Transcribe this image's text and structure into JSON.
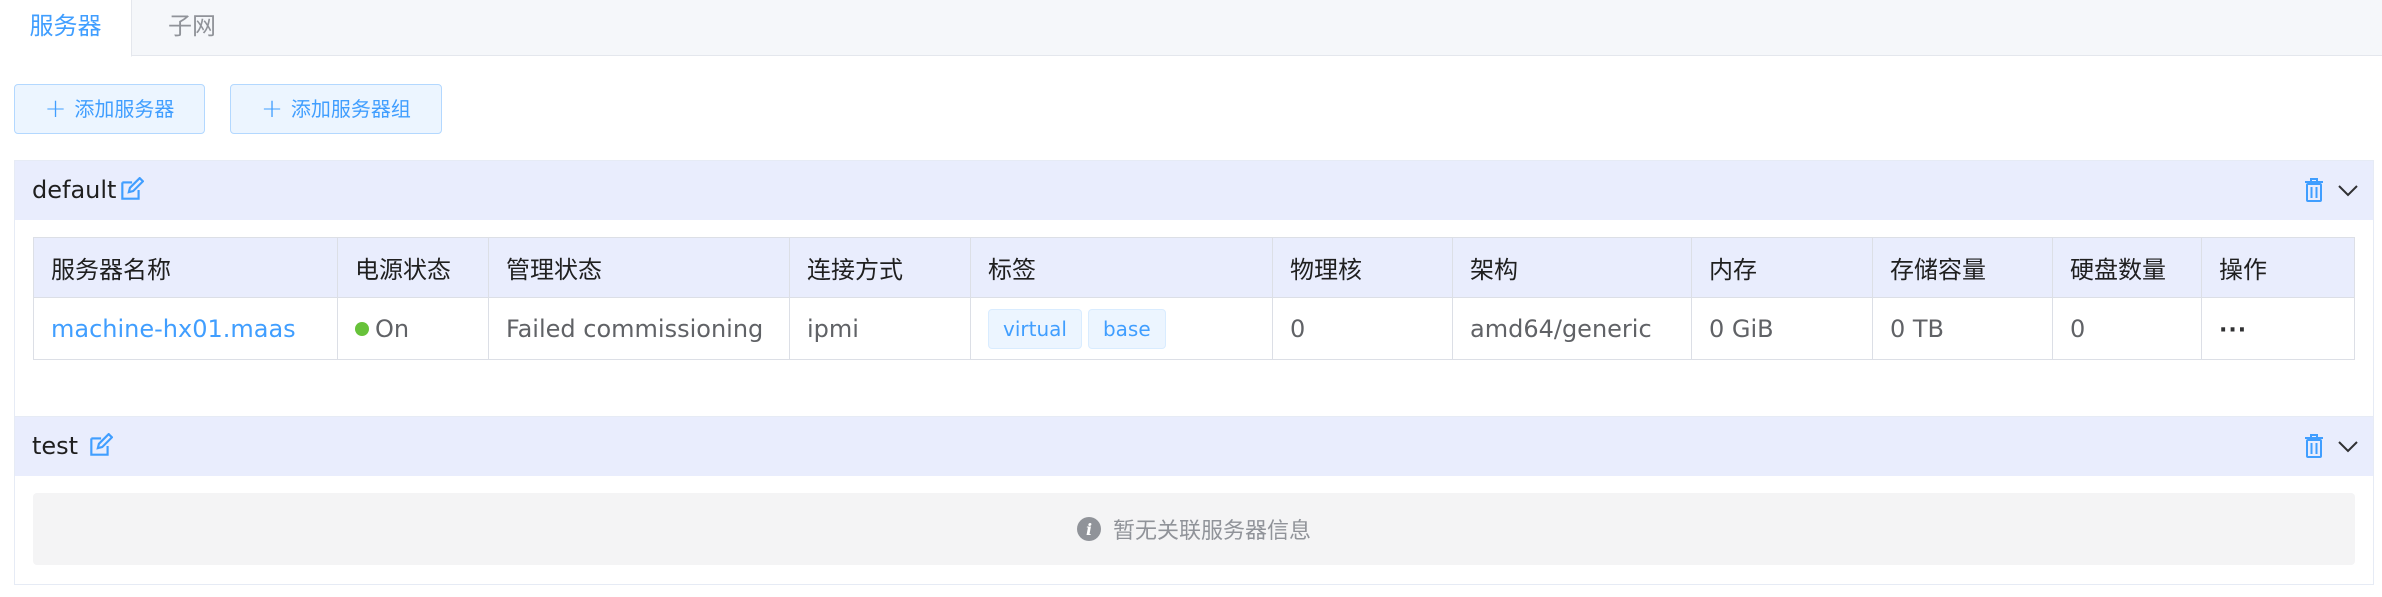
{
  "tabs": [
    {
      "label": "服务器",
      "active": true
    },
    {
      "label": "子网",
      "active": false
    }
  ],
  "toolbar": {
    "add_server_label": "添加服务器",
    "add_group_label": "添加服务器组"
  },
  "groups": [
    {
      "name": "default",
      "columns": [
        "服务器名称",
        "电源状态",
        "管理状态",
        "连接方式",
        "标签",
        "物理核",
        "架构",
        "内存",
        "存储容量",
        "硬盘数量",
        "操作"
      ],
      "rows": [
        {
          "name": "machine-hx01.maas",
          "power": "On",
          "status": "Failed commissioning",
          "connection": "ipmi",
          "tags": [
            "virtual",
            "base"
          ],
          "cores": "0",
          "arch": "amd64/generic",
          "memory": "0 GiB",
          "storage": "0 TB",
          "disks": "0",
          "actions": "···"
        }
      ]
    },
    {
      "name": "test",
      "empty_text": "暂无关联服务器信息"
    }
  ],
  "colors": {
    "accent": "#409eff",
    "header_bg": "#e9edfd",
    "power_on": "#67c23a"
  },
  "icons": [
    "edit-icon",
    "trash-icon",
    "chevron-down-icon",
    "info-icon",
    "plus-icon"
  ]
}
